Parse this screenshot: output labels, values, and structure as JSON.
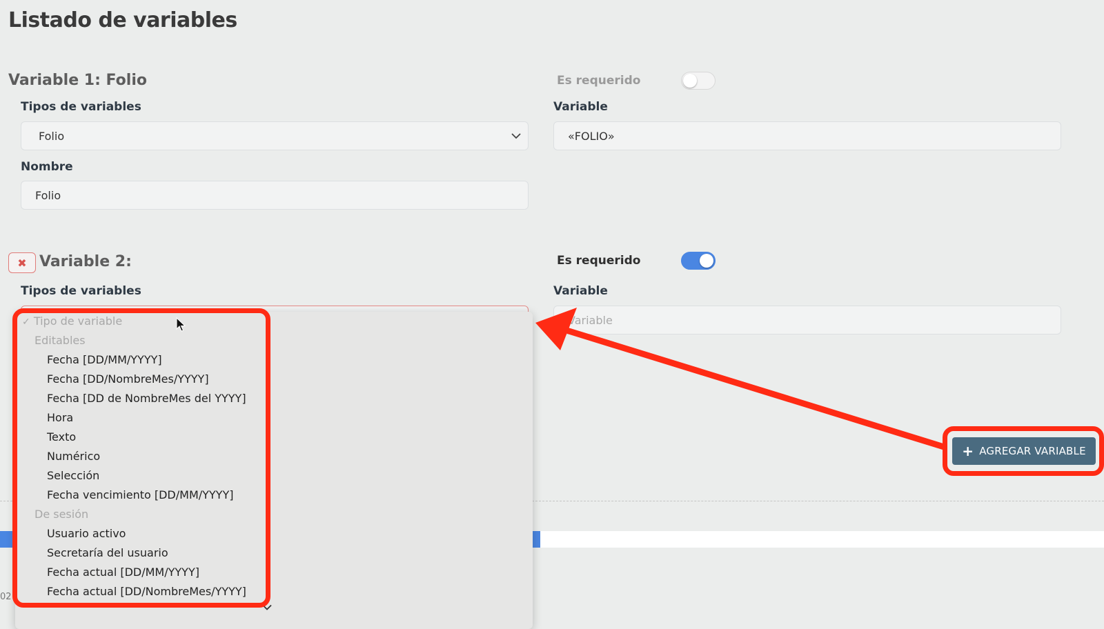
{
  "page": {
    "title": "Listado de variables"
  },
  "variable1": {
    "title": "Variable 1: Folio",
    "required_label": "Es requerido",
    "required": false,
    "types_label": "Tipos de variables",
    "type_value": "Folio",
    "variable_label": "Variable",
    "variable_value": "«FOLIO»",
    "name_label": "Nombre",
    "name_value": "Folio"
  },
  "variable2": {
    "title": "Variable 2:",
    "remove_icon": "close-icon",
    "required_label": "Es requerido",
    "required": true,
    "types_label": "Tipos de variables",
    "variable_label": "Variable",
    "variable_placeholder": "Variable"
  },
  "dropdown": {
    "placeholder": "Tipo de variable",
    "groups": [
      {
        "label": "Editables",
        "options": [
          "Fecha [DD/MM/YYYY]",
          "Fecha [DD/NombreMes/YYYY]",
          "Fecha [DD de NombreMes del YYYY]",
          "Hora",
          "Texto",
          "Numérico",
          "Selección",
          "Fecha vencimiento [DD/MM/YYYY]"
        ]
      },
      {
        "label": "De sesión",
        "options": [
          "Usuario activo",
          "Secretaría del usuario",
          "Fecha actual [DD/MM/YYYY]",
          "Fecha actual [DD/NombreMes/YYYY]"
        ]
      }
    ]
  },
  "actions": {
    "add_variable": "AGREGAR VARIABLE"
  },
  "footer": {
    "fragment": "02"
  },
  "colors": {
    "toggle_on": "#4a86e2",
    "annotation": "#ff2b14",
    "add_button": "#4a6b80",
    "progress": "#4a86e2"
  }
}
